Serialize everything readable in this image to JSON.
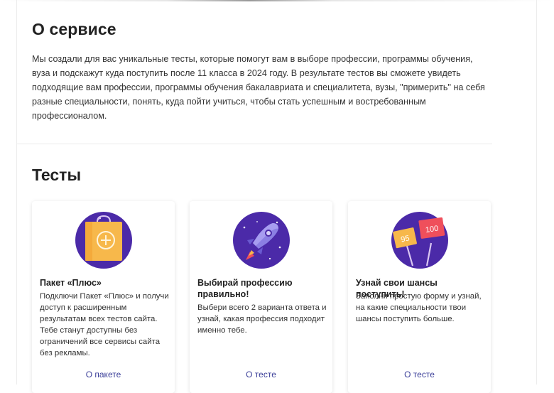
{
  "about": {
    "title": "О сервисе",
    "text": "Мы создали для вас уникальные тесты, которые помогут вам в выборе профессии, программы обучения, вуза и подскажут куда поступить после 11 класса в 2024 году. В результате тестов вы сможете увидеть подходящие вам профессии, программы обучения бакалавриата и специалитета, вузы, \"примерить\" на себя разные специальности, понять, куда пойти учиться, чтобы стать успешным и востребованным профессионалом."
  },
  "tests": {
    "title": "Тесты",
    "cards": [
      {
        "icon": "shopping-bag-plus-icon",
        "title": "Пакет «Плюс»",
        "description": "Подключи Пакет «Плюс» и получи доступ к расширенным результатам всех тестов сайта. Тебе станут доступны без ограничений все сервисы сайта без рекламы.",
        "link": "О пакете"
      },
      {
        "icon": "rocket-icon",
        "title": "Выбирай профессию правильно!",
        "description": "Выбери всего 2 варианта ответа и узнай, какая профессия подходит именно тебе.",
        "link": "О тесте"
      },
      {
        "icon": "score-signs-icon",
        "title": "Узнай свои шансы поступить!",
        "description": "Заполни простую форму и узнай, на какие специальности твои шансы поступить больше.",
        "link": "О тесте",
        "sign_left": "95",
        "sign_right": "100"
      }
    ]
  },
  "colors": {
    "circle": "#4b2aa8",
    "bag": "#f7b84b",
    "sign_left": "#f7b84b",
    "sign_right": "#ef4f5b",
    "link": "#3b3f99"
  }
}
